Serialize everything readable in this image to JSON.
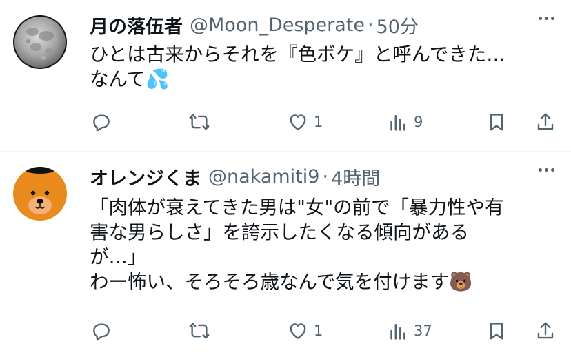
{
  "tweets": [
    {
      "avatar": "moon-avatar",
      "display_name": "月の落伍者",
      "handle": "@Moon_Desperate",
      "separator": "·",
      "time": "50分",
      "lines": [
        "ひとは古来からそれを『色ボケ』と呼んできた…",
        "なんて"
      ],
      "emoji": "💦",
      "emoji_name": "sweat-droplets-emoji",
      "actions": {
        "reply_count": "",
        "retweet_count": "",
        "like_count": "1",
        "view_count": "9"
      }
    },
    {
      "avatar": "orange-bear-avatar",
      "display_name": "オレンジくま",
      "handle": "@nakamiti9",
      "separator": "·",
      "time": "4時間",
      "lines": [
        "「肉体が衰えてきた男は\"女\"の前で「暴力性や有",
        "害な男らしさ」を誇示したくなる傾向がある",
        "が…」",
        "わー怖い、そろそろ歳なんで気を付けます"
      ],
      "emoji": "🐻",
      "emoji_name": "bear-emoji",
      "actions": {
        "reply_count": "",
        "retweet_count": "",
        "like_count": "1",
        "view_count": "37"
      }
    }
  ],
  "colors": {
    "text": "#0f1419",
    "secondary": "#536471",
    "divider": "#eff3f4"
  }
}
